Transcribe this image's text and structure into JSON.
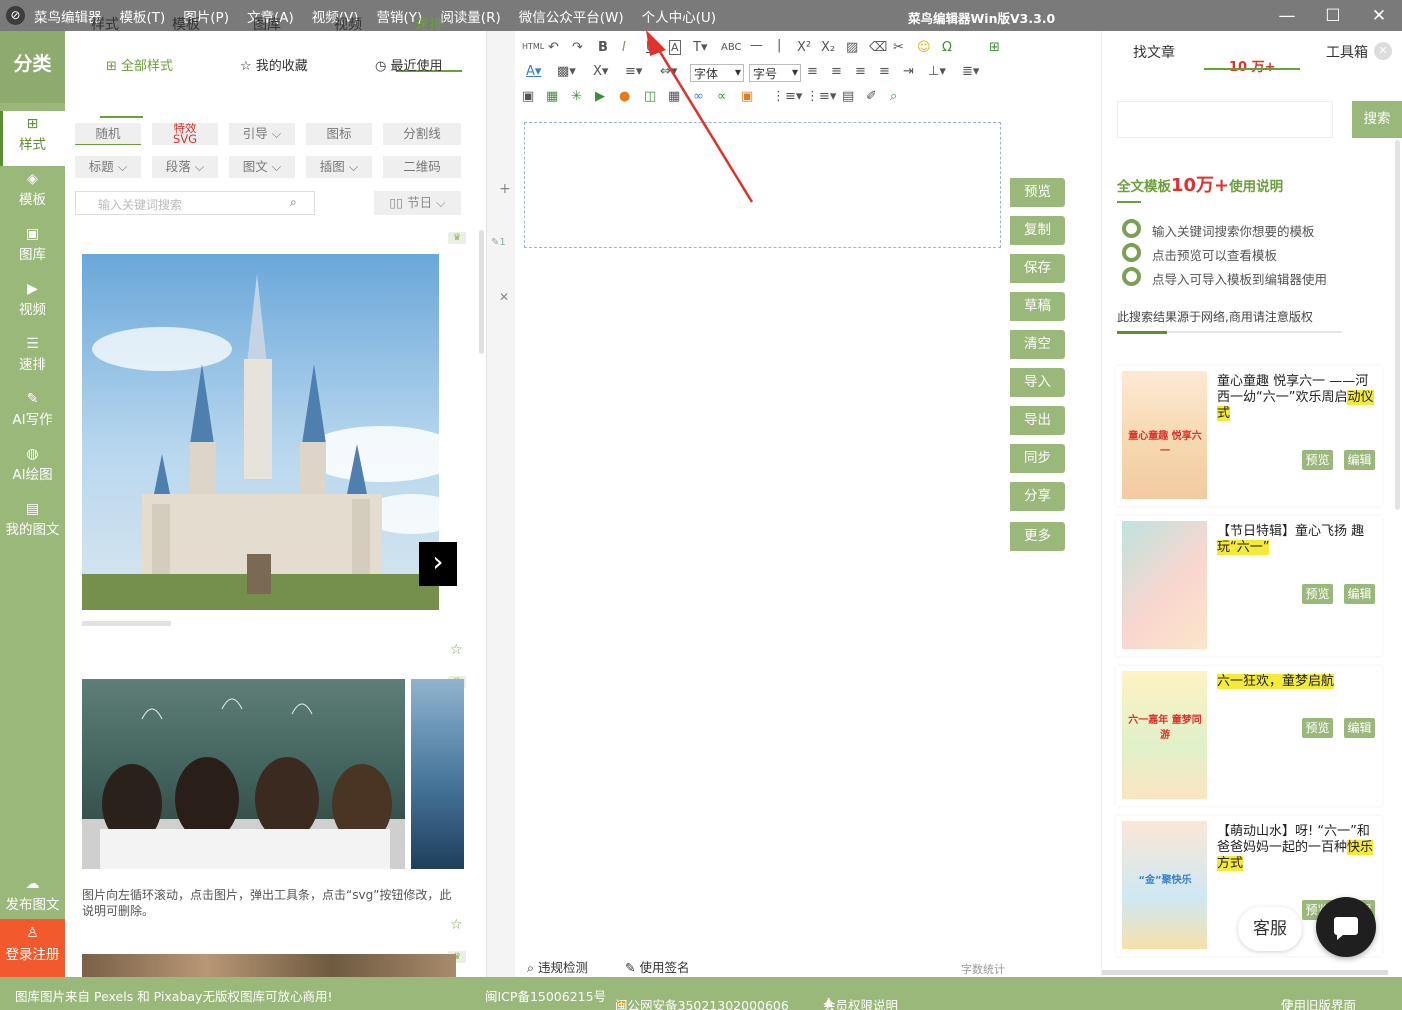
{
  "app": {
    "logo": "⊘",
    "menus": [
      "菜鸟编辑器",
      "模板(T)",
      "图片(P)",
      "文章(A)",
      "视频(V)",
      "营销(Y)",
      "阅读量(R)",
      "微信公众平台(W)",
      "个人中心(U)"
    ],
    "title": "菜鸟编辑器Win版V3.3.0"
  },
  "sidebar": {
    "header": "分类",
    "items": [
      {
        "label": "样式",
        "icon": "grid-icon"
      },
      {
        "label": "模板",
        "icon": "layers-icon"
      },
      {
        "label": "图库",
        "icon": "image-icon"
      },
      {
        "label": "视频",
        "icon": "video-icon"
      },
      {
        "label": "速排",
        "icon": "sliders-icon"
      },
      {
        "label": "AI写作",
        "icon": "pen-icon"
      },
      {
        "label": "AI绘图",
        "icon": "palette-icon"
      },
      {
        "label": "我的图文",
        "icon": "document-icon"
      }
    ],
    "publish": "发布图文",
    "login": "登录注册"
  },
  "panel": {
    "tabs": [
      "样式",
      "模板",
      "图库",
      "视频",
      "速排"
    ],
    "active_tab": "速排",
    "subtabs": [
      "全部样式",
      "我的收藏",
      "最近使用"
    ],
    "chips_row1": [
      "随机",
      "特效\nSVG",
      "引导",
      "图标",
      "分割线"
    ],
    "chips_row2": [
      "标题",
      "段落",
      "图文",
      "插图",
      "二维码"
    ],
    "search_placeholder": "输入关键词搜索",
    "festival": "节日",
    "caption": "图片向左循环滚动，点击图片，弹出工具条，点击“svg”按钮修改，此说明可删除。"
  },
  "editor": {
    "font_family": "字体",
    "font_size": "字号",
    "line_tag": "1",
    "status": {
      "check": "违规检测",
      "sign": "使用签名",
      "count": "字数统计"
    }
  },
  "actions": [
    "预览",
    "复制",
    "保存",
    "草稿",
    "清空",
    "导入",
    "导出",
    "同步",
    "分享",
    "更多"
  ],
  "right": {
    "tabs": [
      "找文章",
      "10 万+",
      "工具箱"
    ],
    "search_button": "搜索",
    "heading_prefix": "全文模板",
    "heading_highlight": "10万+",
    "heading_suffix": "使用说明",
    "tips": [
      "输入关键词搜索你想要的模板",
      "点击预览可以查看模板",
      "点导入可导入模板到编辑器使用"
    ],
    "source_note": "此搜索结果源于网络,商用请注意版权",
    "cards": [
      {
        "title_plain": "童心童趣 悦享六一 ——河西一幼“六一”欢乐周启",
        "title_hl": "动仪式",
        "preview": "预览",
        "edit": "编辑",
        "thumb_text": "童心童趣 悦享六一"
      },
      {
        "title_plain": "【节日特辑】童心飞扬 趣",
        "title_hl": "玩“六一”",
        "preview": "预览",
        "edit": "编辑",
        "thumb_text": ""
      },
      {
        "title_plain": "",
        "title_hl": "六一狂欢，童梦启航",
        "preview": "预览",
        "edit": "编辑",
        "thumb_text": "六一嘉年 童梦同游"
      },
      {
        "title_plain": "【萌动山水】呀! “六一”和爸爸妈妈一起的一百种",
        "title_hl": "快乐方式",
        "preview": "预览",
        "edit": "编辑",
        "thumb_text": "“金”聚快乐"
      }
    ],
    "service": "客服"
  },
  "footer": {
    "left": "图库图片来自 Pexels 和 Pixabay无版权图库可放心商用!",
    "icp": "闽ICP备15006215号",
    "police": "闽公网安备35021302000606",
    "member": "会员权限说明",
    "old": "使用旧版界面"
  },
  "colors": {
    "brand_green": "#9bb87b",
    "title_bar": "#7a7a7a",
    "login_orange": "#f2592c",
    "highlight": "#f4ea3a",
    "red": "#e0312a"
  }
}
